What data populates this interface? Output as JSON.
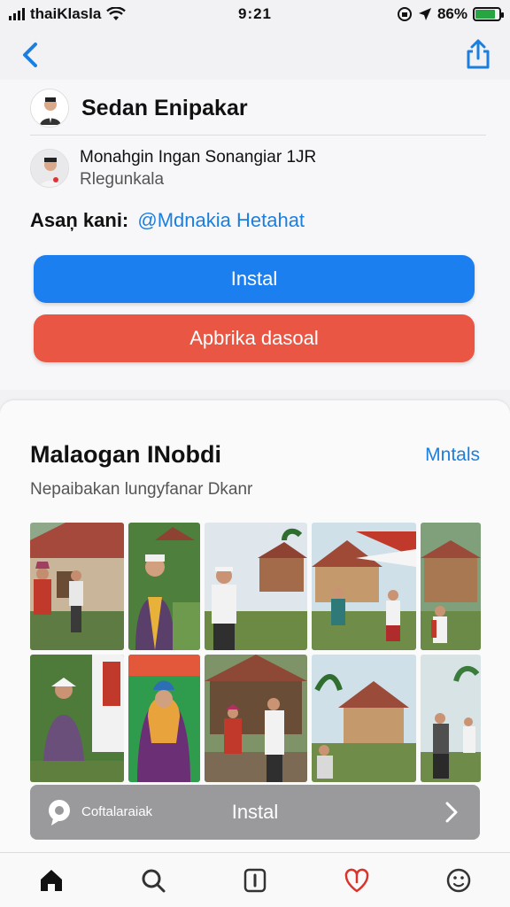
{
  "status_bar": {
    "carrier": "thaiKlasla",
    "time": "9:21",
    "battery": "86%",
    "battery_level": 0.86
  },
  "nav": {
    "back_icon": "chevron-left-icon",
    "share_icon": "share-icon"
  },
  "header": {
    "title": "Sedan Enipakar"
  },
  "publisher": {
    "name": "Monahgin Ingan Sonangiar 1JR",
    "subtitle": "Rlegunkala"
  },
  "developer": {
    "prefix": "Asaņ kani:",
    "link": "@Mdnakia Hetahat"
  },
  "buttons": {
    "install": "Instal",
    "secondary": "Apbrika dasoal"
  },
  "gallery": {
    "title": "Malaogan INobdi",
    "more": "Mntals",
    "subtitle": "Nepaibakan lungyfanar Dkanr",
    "photos": [
      "photo-1",
      "photo-2",
      "photo-3",
      "photo-4",
      "photo-5",
      "photo-6",
      "photo-7",
      "photo-8",
      "photo-9",
      "photo-10"
    ]
  },
  "action_bar": {
    "icon": "chat-bubble-icon",
    "label": "Coftalaraiak",
    "title": "Instal",
    "arrow": "chevron-right-icon"
  },
  "tab_bar": {
    "items": [
      {
        "name": "home-icon"
      },
      {
        "name": "search-icon"
      },
      {
        "name": "info-icon"
      },
      {
        "name": "heart-icon"
      },
      {
        "name": "smiley-icon"
      }
    ]
  },
  "colors": {
    "accent": "#1c7ff0",
    "danger": "#ea5644",
    "link": "#1b7fe0",
    "battery": "#26a541"
  }
}
